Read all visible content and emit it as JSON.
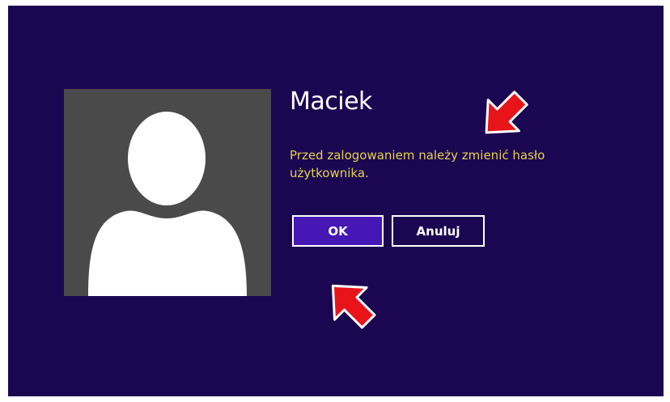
{
  "user": {
    "name": "Maciek"
  },
  "message": {
    "text": "Przed zalogowaniem należy zmienić hasło użytkownika."
  },
  "buttons": {
    "ok_label": "OK",
    "cancel_label": "Anuluj"
  },
  "icons": {
    "avatar": "user-silhouette-icon",
    "annotation_arrow_top": "red-arrow-icon",
    "annotation_arrow_bottom": "red-arrow-icon"
  },
  "colors": {
    "background": "#1b0751",
    "avatar_tile": "#4a4a4a",
    "message_text": "#e6d24a",
    "ok_button": "#4617b4",
    "arrow": "#e8141a"
  }
}
